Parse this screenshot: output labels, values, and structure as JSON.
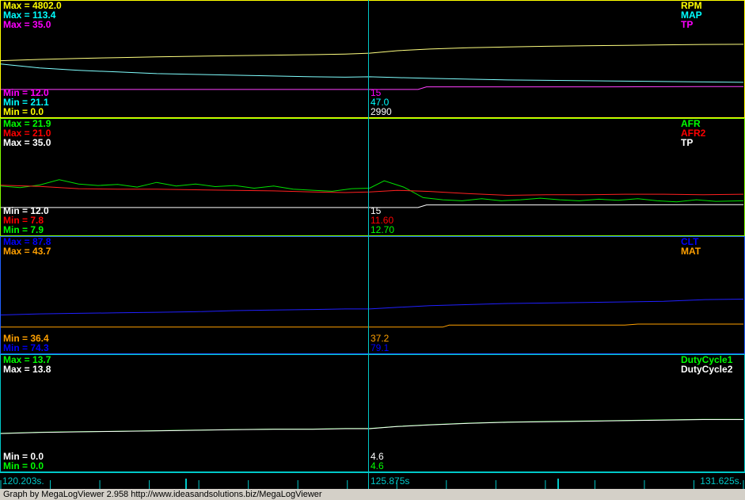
{
  "chart_data": [
    {
      "type": "line",
      "border_color": "#ffff00",
      "labels_left": [
        {
          "text": "Max = 4802.0",
          "color": "#ffff00",
          "pos": "top",
          "row": 0
        },
        {
          "text": "Max = 113.4",
          "color": "#00ffff",
          "pos": "top",
          "row": 1
        },
        {
          "text": "Max = 35.0",
          "color": "#ff00ff",
          "pos": "top",
          "row": 2
        },
        {
          "text": "Min = 12.0",
          "color": "#ff00ff",
          "pos": "bottom",
          "row": 2
        },
        {
          "text": "Min = 21.1",
          "color": "#00ffff",
          "pos": "bottom",
          "row": 1
        },
        {
          "text": "Min = 0.0",
          "color": "#ffff00",
          "pos": "bottom",
          "row": 0
        }
      ],
      "labels_right": [
        {
          "text": "RPM",
          "color": "#ffff00"
        },
        {
          "text": "MAP",
          "color": "#00ffff"
        },
        {
          "text": "TP",
          "color": "#ff00ff"
        }
      ],
      "cursor_values": [
        {
          "text": "15",
          "color": "#ff00ff"
        },
        {
          "text": "47.0",
          "color": "#00ffff"
        },
        {
          "text": "2990",
          "color": "#ffffff"
        }
      ],
      "series": [
        {
          "name": "RPM",
          "color": "#ffff80",
          "min": 0.0,
          "max": 4802.0,
          "x": [
            120.2,
            120.8,
            121.4,
            122.0,
            122.6,
            123.2,
            123.8,
            124.4,
            125.0,
            125.5,
            125.875,
            126.3,
            126.8,
            127.4,
            128.0,
            128.6,
            129.2,
            129.8,
            130.4,
            131.0,
            131.625
          ],
          "y": [
            2500,
            2580,
            2650,
            2700,
            2750,
            2790,
            2830,
            2860,
            2890,
            2930,
            2990,
            3150,
            3260,
            3340,
            3400,
            3440,
            3470,
            3500,
            3530,
            3560,
            3570
          ]
        },
        {
          "name": "MAP",
          "color": "#80ffff",
          "min": 21.1,
          "max": 113.4,
          "x": [
            120.2,
            120.8,
            121.4,
            122.0,
            122.6,
            123.2,
            123.8,
            124.4,
            125.0,
            125.5,
            125.875,
            126.3,
            126.8,
            127.4,
            128.0,
            128.6,
            129.2,
            129.8,
            130.4,
            131.0,
            131.625
          ],
          "y": [
            65,
            60,
            57,
            55,
            53,
            52,
            51,
            50,
            49,
            48.5,
            49,
            48,
            47,
            46,
            45,
            44.5,
            44,
            43.5,
            43,
            42.5,
            42
          ]
        },
        {
          "name": "TP",
          "color": "#ff40ff",
          "min": 12.0,
          "max": 35.0,
          "x": [
            120.2,
            121.5,
            123.0,
            124.5,
            125.875,
            126.5,
            126.62,
            126.75,
            128.0,
            129.5,
            131.0,
            131.625
          ],
          "y": [
            15,
            15,
            15,
            15,
            15,
            15,
            15,
            15.8,
            15.8,
            15.8,
            15.9,
            15.9
          ]
        }
      ]
    },
    {
      "type": "line",
      "border_color": "#80ff00",
      "labels_left": [
        {
          "text": "Max = 21.9",
          "color": "#00ff00",
          "pos": "top",
          "row": 0
        },
        {
          "text": "Max = 21.0",
          "color": "#ff0000",
          "pos": "top",
          "row": 1
        },
        {
          "text": "Max = 35.0",
          "color": "#ffffff",
          "pos": "top",
          "row": 2
        },
        {
          "text": "Min = 12.0",
          "color": "#ffffff",
          "pos": "bottom",
          "row": 2
        },
        {
          "text": "Min = 7.8",
          "color": "#ff0000",
          "pos": "bottom",
          "row": 1
        },
        {
          "text": "Min = 7.9",
          "color": "#00ff00",
          "pos": "bottom",
          "row": 0
        }
      ],
      "labels_right": [
        {
          "text": "AFR",
          "color": "#00ff00"
        },
        {
          "text": "AFR2",
          "color": "#ff0000"
        },
        {
          "text": "TP",
          "color": "#ffffff"
        }
      ],
      "cursor_values": [
        {
          "text": "15",
          "color": "#ffffff"
        },
        {
          "text": "11.60",
          "color": "#ff0000"
        },
        {
          "text": "12.70",
          "color": "#00ff00"
        }
      ],
      "series": [
        {
          "name": "AFR",
          "color": "#00e000",
          "min": 7.9,
          "max": 21.9,
          "x": [
            120.2,
            120.5,
            120.8,
            121.1,
            121.4,
            121.7,
            122.0,
            122.3,
            122.6,
            122.9,
            123.2,
            123.5,
            123.8,
            124.1,
            124.4,
            124.7,
            125.0,
            125.3,
            125.6,
            125.875,
            126.1,
            126.4,
            126.7,
            127.0,
            127.3,
            127.6,
            127.9,
            128.2,
            128.5,
            128.8,
            129.1,
            129.4,
            129.7,
            130.0,
            130.3,
            130.6,
            130.9,
            131.2,
            131.625
          ],
          "y": [
            13.8,
            13.5,
            14.0,
            15.0,
            14.2,
            13.9,
            14.1,
            13.6,
            14.5,
            13.8,
            14.2,
            13.7,
            13.9,
            13.4,
            13.8,
            13.2,
            13.0,
            12.8,
            13.3,
            13.4,
            14.8,
            13.6,
            11.6,
            11.2,
            11.0,
            11.4,
            11.0,
            11.2,
            11.5,
            11.2,
            11.0,
            11.3,
            11.1,
            11.4,
            11.0,
            10.8,
            11.2,
            10.9,
            11.0
          ]
        },
        {
          "name": "AFR2",
          "color": "#ff2020",
          "min": 7.8,
          "max": 21.0,
          "x": [
            120.2,
            120.8,
            121.4,
            122.0,
            122.6,
            123.2,
            123.8,
            124.4,
            125.0,
            125.5,
            125.875,
            126.3,
            126.8,
            127.4,
            128.0,
            128.6,
            129.2,
            129.8,
            130.4,
            131.0,
            131.625
          ],
          "y": [
            13.5,
            13.3,
            12.9,
            12.8,
            12.8,
            12.7,
            12.6,
            12.5,
            12.3,
            12.2,
            12.3,
            12.6,
            12.4,
            12.0,
            11.7,
            11.8,
            11.8,
            11.9,
            11.9,
            11.8,
            11.9
          ]
        },
        {
          "name": "TP",
          "color": "#ffffff",
          "min": 12.0,
          "max": 35.0,
          "x": [
            120.2,
            121.5,
            123.0,
            124.5,
            125.875,
            126.5,
            126.62,
            126.75,
            128.0,
            129.5,
            131.0,
            131.625
          ],
          "y": [
            15,
            15,
            15,
            15,
            15,
            15,
            15,
            15.8,
            15.8,
            15.8,
            15.9,
            15.9
          ]
        }
      ]
    },
    {
      "type": "line",
      "border_color": "#2060ff",
      "labels_left": [
        {
          "text": "Max = 87.8",
          "color": "#0000ff",
          "pos": "top",
          "row": 0
        },
        {
          "text": "Max = 43.7",
          "color": "#ffa000",
          "pos": "top",
          "row": 1
        },
        {
          "text": "Min = 36.4",
          "color": "#ffa000",
          "pos": "bottom",
          "row": 1
        },
        {
          "text": "Min = 74.3",
          "color": "#0000ff",
          "pos": "bottom",
          "row": 0
        }
      ],
      "labels_right": [
        {
          "text": "CLT",
          "color": "#0000ff"
        },
        {
          "text": "MAT",
          "color": "#ffa000"
        }
      ],
      "cursor_values": [
        {
          "text": "37.2",
          "color": "#ffa000"
        },
        {
          "text": "79.1",
          "color": "#0000ff"
        }
      ],
      "series": [
        {
          "name": "CLT",
          "color": "#2020ff",
          "min": 74.3,
          "max": 87.8,
          "x": [
            120.2,
            120.8,
            121.4,
            122.0,
            122.6,
            123.2,
            123.8,
            124.4,
            125.0,
            125.5,
            125.875,
            126.3,
            126.8,
            127.4,
            128.0,
            128.6,
            129.2,
            129.8,
            130.4,
            131.0,
            131.625
          ],
          "y": [
            78.0,
            78.2,
            78.3,
            78.4,
            78.5,
            78.6,
            78.8,
            78.9,
            79.0,
            79.1,
            79.1,
            79.4,
            79.7,
            79.9,
            80.1,
            80.2,
            80.3,
            80.4,
            80.5,
            80.8,
            80.9
          ]
        },
        {
          "name": "MAT",
          "color": "#ffa000",
          "min": 36.4,
          "max": 43.7,
          "x": [
            120.2,
            121.5,
            123.0,
            124.5,
            125.875,
            126.5,
            127.0,
            127.1,
            128.5,
            129.8,
            130.0,
            131.625
          ],
          "y": [
            37.2,
            37.2,
            37.2,
            37.2,
            37.2,
            37.2,
            37.2,
            37.4,
            37.4,
            37.4,
            37.5,
            37.5
          ]
        }
      ]
    },
    {
      "type": "line",
      "border_color": "#00c8c8",
      "labels_left": [
        {
          "text": "Max = 13.7",
          "color": "#00ff00",
          "pos": "top",
          "row": 0
        },
        {
          "text": "Max = 13.8",
          "color": "#ffffff",
          "pos": "top",
          "row": 1
        },
        {
          "text": "Min = 0.0",
          "color": "#ffffff",
          "pos": "bottom",
          "row": 1
        },
        {
          "text": "Min = 0.0",
          "color": "#00ff00",
          "pos": "bottom",
          "row": 0
        }
      ],
      "labels_right": [
        {
          "text": "DutyCycle1",
          "color": "#00ff00"
        },
        {
          "text": "DutyCycle2",
          "color": "#ffffff"
        }
      ],
      "cursor_values": [
        {
          "text": "4.6",
          "color": "#ffffff"
        },
        {
          "text": "4.6",
          "color": "#00ff00"
        }
      ],
      "series": [
        {
          "name": "DutyCycle1",
          "color": "#40ff40",
          "min": 0.0,
          "max": 13.7,
          "x": [
            120.2,
            120.8,
            121.4,
            122.0,
            122.6,
            123.2,
            123.8,
            124.4,
            125.0,
            125.5,
            125.875,
            126.3,
            126.8,
            127.4,
            128.0,
            128.6,
            129.2,
            129.8,
            130.4,
            131.0,
            131.625
          ],
          "y": [
            3.7,
            3.9,
            4.0,
            4.1,
            4.2,
            4.3,
            4.4,
            4.5,
            4.5,
            4.6,
            4.6,
            5.0,
            5.3,
            5.6,
            5.8,
            5.9,
            6.0,
            6.1,
            6.2,
            6.3,
            6.3
          ]
        },
        {
          "name": "DutyCycle2",
          "color": "#ffffff",
          "min": 0.0,
          "max": 13.8,
          "x": [
            120.2,
            120.8,
            121.4,
            122.0,
            122.6,
            123.2,
            123.8,
            124.4,
            125.0,
            125.5,
            125.875,
            126.3,
            126.8,
            127.4,
            128.0,
            128.6,
            129.2,
            129.8,
            130.4,
            131.0,
            131.625
          ],
          "y": [
            3.7,
            3.9,
            4.0,
            4.1,
            4.2,
            4.3,
            4.4,
            4.5,
            4.5,
            4.6,
            4.6,
            5.0,
            5.3,
            5.6,
            5.8,
            5.9,
            6.0,
            6.1,
            6.2,
            6.3,
            6.3
          ]
        }
      ]
    }
  ],
  "x_axis": {
    "start": 120.203,
    "cursor": 125.875,
    "end": 131.625,
    "start_label": "120.203s.",
    "cursor_label": "125.875s",
    "end_label": "131.625s.",
    "tick_color": "#00c8c8"
  },
  "cursor_color": "#00c8c8",
  "footer": {
    "text": "Graph by MegaLogViewer 2.958 http://www.ideasandsolutions.biz/MegaLogViewer"
  }
}
